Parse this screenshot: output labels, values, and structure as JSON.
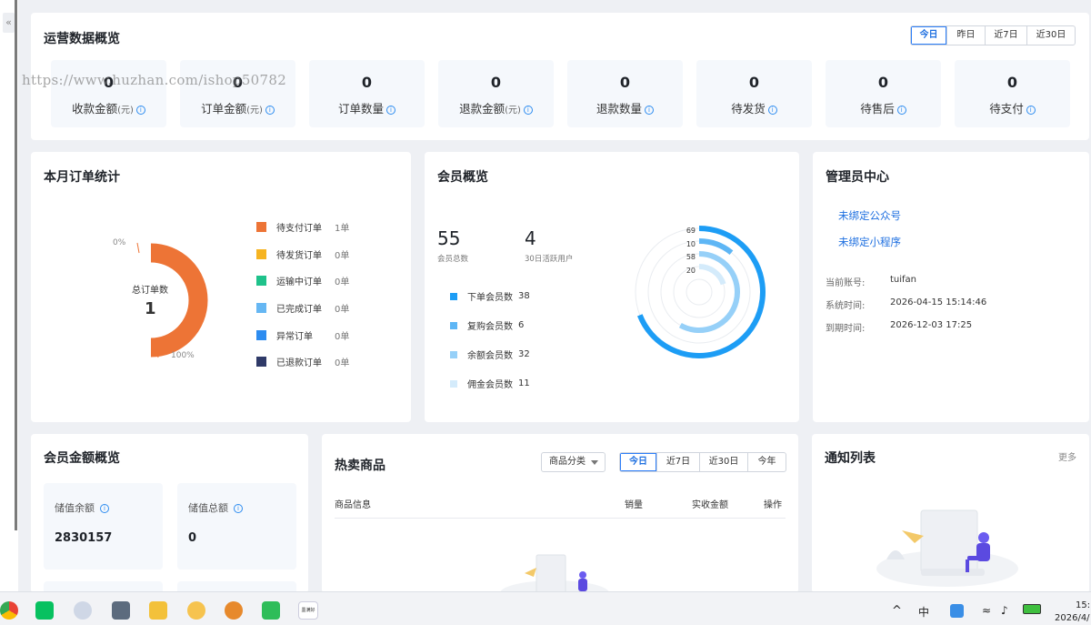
{
  "sidebar": {
    "collapse_glyph": "«"
  },
  "ops": {
    "title": "运营数据概览",
    "ranges": [
      "今日",
      "昨日",
      "近7日",
      "近30日"
    ],
    "stats": [
      {
        "value": "0",
        "label": "收款金额",
        "unit": "(元)"
      },
      {
        "value": "0",
        "label": "订单金额",
        "unit": "(元)"
      },
      {
        "value": "0",
        "label": "订单数量",
        "unit": ""
      },
      {
        "value": "0",
        "label": "退款金额",
        "unit": "(元)"
      },
      {
        "value": "0",
        "label": "退款数量",
        "unit": ""
      },
      {
        "value": "0",
        "label": "待发货",
        "unit": ""
      },
      {
        "value": "0",
        "label": "待售后",
        "unit": ""
      },
      {
        "value": "0",
        "label": "待支付",
        "unit": ""
      }
    ],
    "info_icon": "i",
    "watermark": "https://www.huzhan.com/ishop50782"
  },
  "orders": {
    "title": "本月订单统计",
    "center_label": "总订单数",
    "center_value": "1",
    "pct_top": "0%",
    "pct_bottom": "100%",
    "legend": [
      {
        "name": "待支付订单",
        "value": "1单",
        "color": "#ed7436"
      },
      {
        "name": "待发货订单",
        "value": "0单",
        "color": "#f6b421"
      },
      {
        "name": "运输中订单",
        "value": "0单",
        "color": "#1fc28b"
      },
      {
        "name": "已完成订单",
        "value": "0单",
        "color": "#66b7f3"
      },
      {
        "name": "异常订单",
        "value": "0单",
        "color": "#2d8cf0"
      },
      {
        "name": "已退款订单",
        "value": "0单",
        "color": "#2f3a68"
      }
    ]
  },
  "members": {
    "title": "会员概览",
    "total_value": "55",
    "total_label": "会员总数",
    "active_value": "4",
    "active_label": "30日活跃用户",
    "legend": [
      {
        "name": "下单会员数",
        "value": "38",
        "color": "#1d9df5"
      },
      {
        "name": "复购会员数",
        "value": "6",
        "color": "#5eb6f5"
      },
      {
        "name": "余额会员数",
        "value": "32",
        "color": "#96d0f8"
      },
      {
        "name": "佣金会员数",
        "value": "11",
        "color": "#d4ebfb"
      }
    ],
    "ring_labels": [
      "69",
      "10",
      "58",
      "20"
    ]
  },
  "chart_data": {
    "type": "pie",
    "title": "会员概览",
    "categories": [
      "下单会员数",
      "复购会员数",
      "余额会员数",
      "佣金会员数"
    ],
    "values": [
      38,
      6,
      32,
      11
    ],
    "ring_max": 55,
    "ring_labels": [
      "69",
      "10",
      "58",
      "20"
    ]
  },
  "admin": {
    "title": "管理员中心",
    "links": [
      "未绑定公众号",
      "未绑定小程序"
    ],
    "rows": [
      {
        "k": "当前账号:",
        "v": "tuifan"
      },
      {
        "k": "系统时间:",
        "v": "2026-04-15 15:14:46"
      },
      {
        "k": "到期时间:",
        "v": "2026-12-03 17:25"
      }
    ]
  },
  "balance": {
    "title": "会员金额概览",
    "items": [
      {
        "label": "储值余额",
        "value": "2830157"
      },
      {
        "label": "储值总额",
        "value": "0"
      }
    ]
  },
  "hot": {
    "title": "热卖商品",
    "category_select": "商品分类",
    "ranges": [
      "今日",
      "近7日",
      "近30日",
      "今年"
    ],
    "columns": [
      "商品信息",
      "销量",
      "实收金额",
      "操作"
    ]
  },
  "notice": {
    "title": "通知列表",
    "more": "更多"
  },
  "taskbar": {
    "time": "15:",
    "date": "2026/4/",
    "app_label": "墨满好"
  },
  "colors": {
    "accent": "#1e6fe0",
    "orange": "#ed7436",
    "ring_blue": "#1d9df5"
  }
}
